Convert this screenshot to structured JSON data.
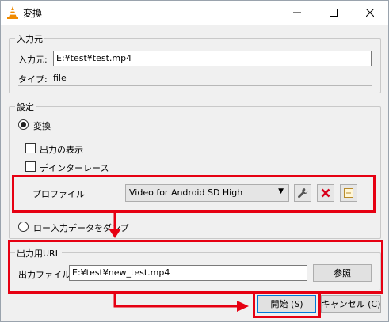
{
  "window": {
    "title": "変換"
  },
  "source": {
    "group_label": "入力元",
    "file_label": "入力元:",
    "file_value": "E:¥test¥test.mp4",
    "type_label": "タイプ:",
    "type_value": "file"
  },
  "settings": {
    "group_label": "設定",
    "convert_label": "変換",
    "show_output_label": "出力の表示",
    "deinterlace_label": "デインターレース",
    "profile_label": "プロファイル",
    "profile_selected": "Video for Android SD High",
    "dump_raw_label": "ロー入力データをダンプ"
  },
  "destination": {
    "group_label": "出力用URL",
    "file_label": "出力ファイル:",
    "file_value": "E:¥test¥new_test.mp4",
    "browse_label": "参照"
  },
  "buttons": {
    "start_label": "開始 (S)",
    "cancel_label": "キャンセル (C)"
  },
  "colors": {
    "highlight": "#e60012",
    "accent": "#0078d7"
  }
}
